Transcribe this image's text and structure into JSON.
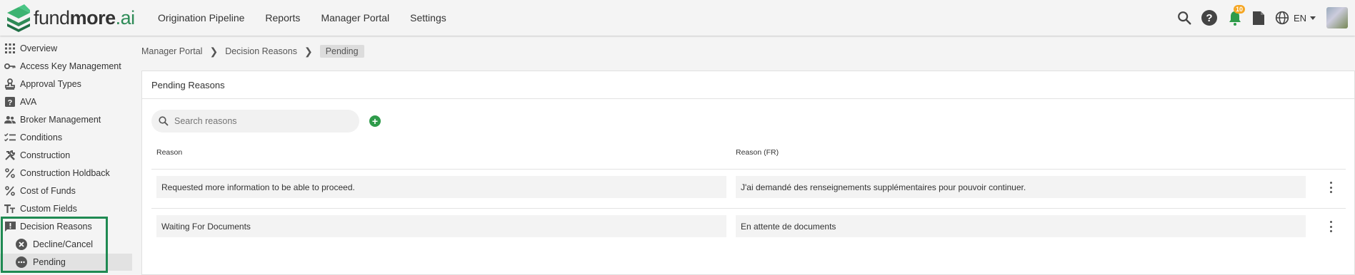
{
  "brand": {
    "name_light": "fund",
    "name_bold": "more",
    "name_suffix": ".ai",
    "accent": "#2e8b57"
  },
  "nav": [
    "Origination Pipeline",
    "Reports",
    "Manager Portal",
    "Settings"
  ],
  "topbar": {
    "notification_count": "10",
    "language": "EN"
  },
  "sidebar": {
    "items": [
      {
        "label": "Overview",
        "icon": "grid-icon"
      },
      {
        "label": "Access Key Management",
        "icon": "key-icon"
      },
      {
        "label": "Approval Types",
        "icon": "stamp-icon"
      },
      {
        "label": "AVA",
        "icon": "help-box-icon"
      },
      {
        "label": "Broker Management",
        "icon": "people-icon"
      },
      {
        "label": "Conditions",
        "icon": "checklist-icon"
      },
      {
        "label": "Construction",
        "icon": "tools-icon"
      },
      {
        "label": "Construction Holdback",
        "icon": "percent-icon"
      },
      {
        "label": "Cost of Funds",
        "icon": "percent-icon"
      },
      {
        "label": "Custom Fields",
        "icon": "text-format-icon"
      },
      {
        "label": "Decision Reasons",
        "icon": "alert-message-icon"
      }
    ],
    "subitems": [
      {
        "label": "Decline/Cancel",
        "icon": "close-circle-icon"
      },
      {
        "label": "Pending",
        "icon": "more-circle-icon"
      }
    ]
  },
  "breadcrumb": [
    "Manager Portal",
    "Decision Reasons",
    "Pending"
  ],
  "card": {
    "title": "Pending Reasons"
  },
  "search": {
    "placeholder": "Search reasons"
  },
  "table": {
    "columns": [
      "Reason",
      "Reason (FR)"
    ],
    "rows": [
      {
        "reason": "Requested more information to be able to proceed.",
        "reason_fr": "J'ai demandé des renseignements supplémentaires pour pouvoir continuer."
      },
      {
        "reason": "Waiting For Documents",
        "reason_fr": "En attente de documents"
      }
    ]
  }
}
